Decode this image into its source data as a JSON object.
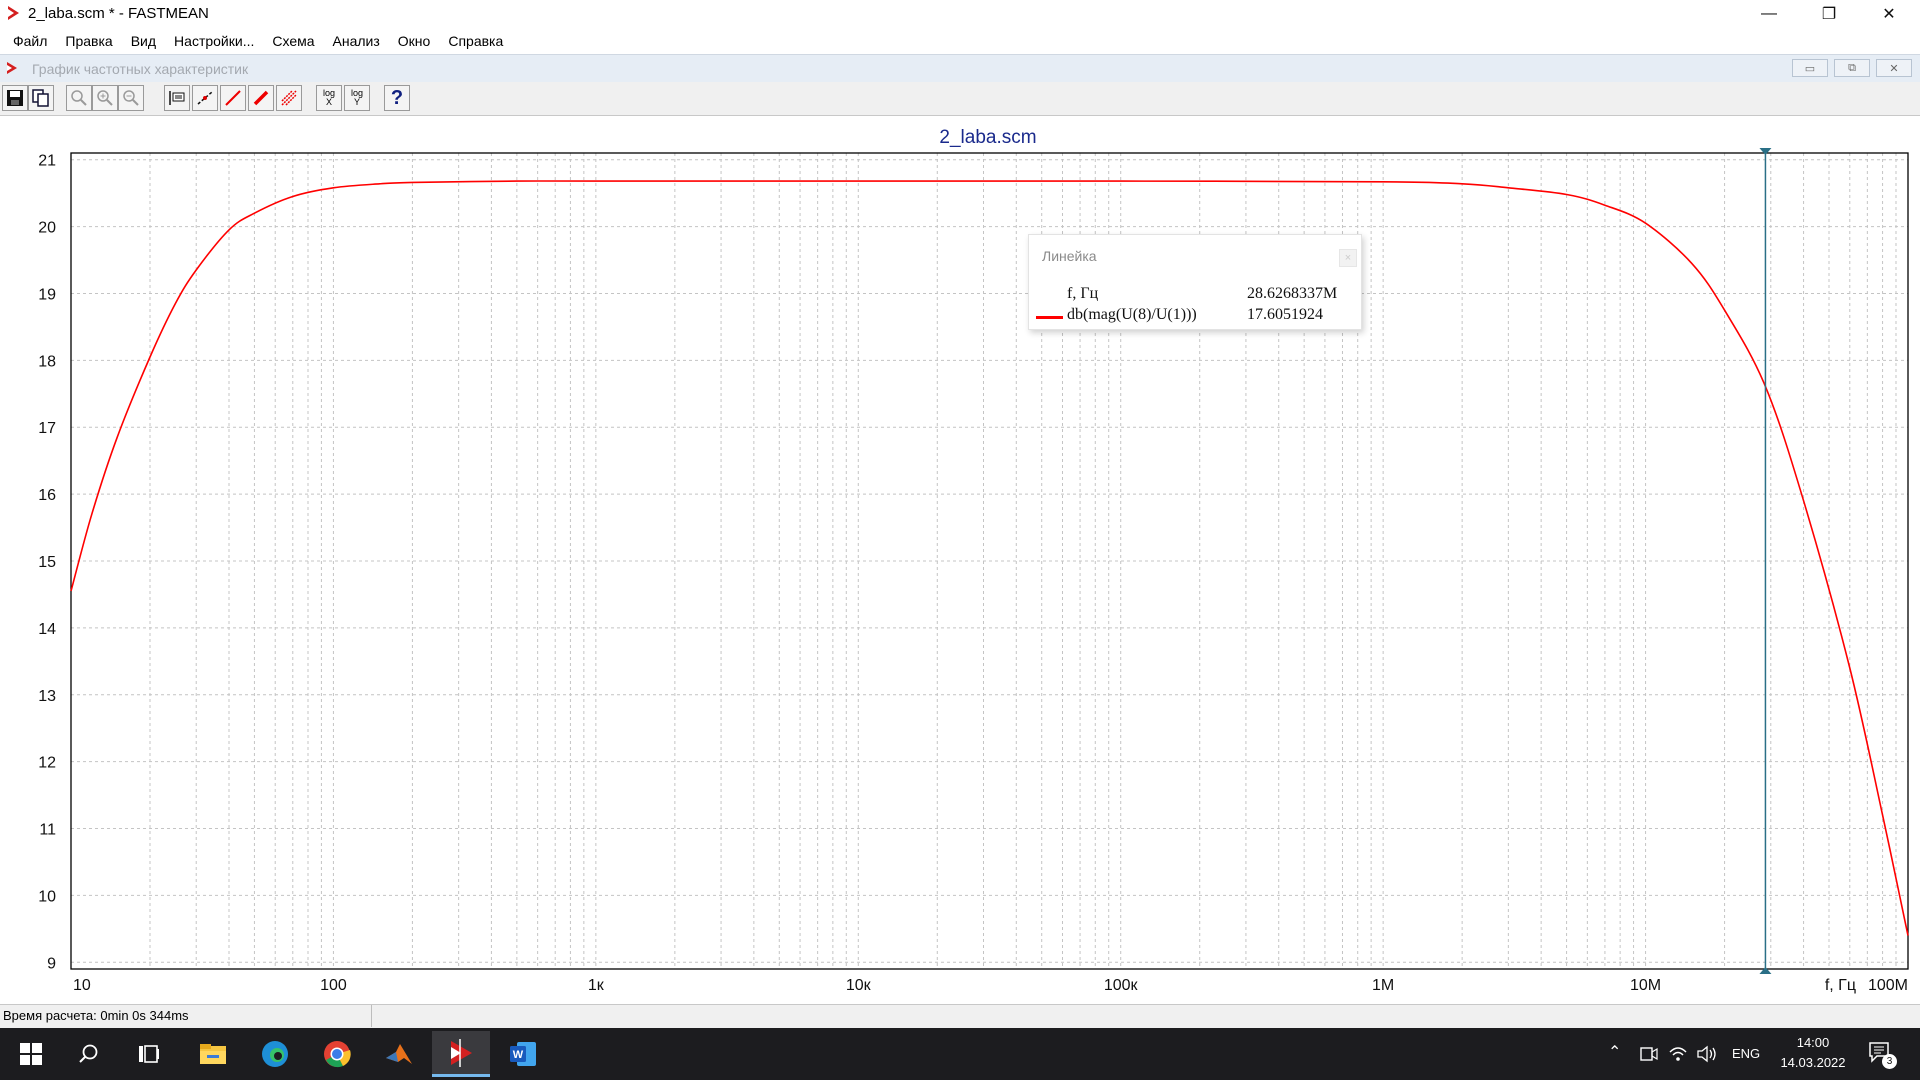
{
  "app": {
    "title": "2_laba.scm * - FASTMEAN",
    "window_controls": [
      "—",
      "❐",
      "✕"
    ]
  },
  "menu": [
    "Файл",
    "Правка",
    "Вид",
    "Настройки...",
    "Схема",
    "Анализ",
    "Окно",
    "Справка"
  ],
  "child_window": {
    "title": "График частотных характеристик",
    "controls": [
      "▭",
      "⧉",
      "✕"
    ]
  },
  "toolbar": {
    "buttons": [
      {
        "name": "save-icon"
      },
      {
        "name": "copy-icon"
      },
      {
        "name": "zoom-icon"
      },
      {
        "name": "zoom-in-icon"
      },
      {
        "name": "zoom-out-icon"
      },
      {
        "name": "ruler-icon"
      },
      {
        "name": "marker-line-icon"
      },
      {
        "name": "red-line-icon"
      },
      {
        "name": "red-pencil-icon"
      },
      {
        "name": "grid-icon"
      },
      {
        "name": "log-x-icon",
        "label_top": "log",
        "label_bottom": "X"
      },
      {
        "name": "log-y-icon",
        "label_top": "log",
        "label_bottom": "Y"
      },
      {
        "name": "help-icon",
        "label": "?"
      }
    ]
  },
  "chart_data": {
    "type": "line",
    "title": "2_laba.scm",
    "x_scale": "log",
    "xlim": [
      10,
      100000000
    ],
    "ylim": [
      8.9,
      21.1
    ],
    "x_tick_labels": [
      {
        "value": 10,
        "label": "10"
      },
      {
        "value": 100,
        "label": "100"
      },
      {
        "value": 1000,
        "label": "1к"
      },
      {
        "value": 10000,
        "label": "10к"
      },
      {
        "value": 100000,
        "label": "100к"
      },
      {
        "value": 1000000,
        "label": "1M"
      },
      {
        "value": 10000000,
        "label": "10M"
      },
      {
        "value": 100000000,
        "label": "100M"
      }
    ],
    "x_axis_name": "f, Гц",
    "y_ticks": [
      9,
      10,
      11,
      12,
      13,
      14,
      15,
      16,
      17,
      18,
      19,
      20,
      21
    ],
    "grid": true,
    "cursor_x": 28626833.7,
    "series": [
      {
        "name": "db(mag(U(8)/U(1)))",
        "color": "#ff0000",
        "points": [
          [
            10,
            14.55
          ],
          [
            12,
            15.7
          ],
          [
            15,
            16.85
          ],
          [
            20,
            18.05
          ],
          [
            25,
            18.85
          ],
          [
            30,
            19.35
          ],
          [
            40,
            19.95
          ],
          [
            50,
            20.2
          ],
          [
            70,
            20.45
          ],
          [
            100,
            20.58
          ],
          [
            150,
            20.64
          ],
          [
            200,
            20.66
          ],
          [
            500,
            20.68
          ],
          [
            1000,
            20.68
          ],
          [
            10000,
            20.68
          ],
          [
            100000,
            20.68
          ],
          [
            1000000,
            20.67
          ],
          [
            2000000,
            20.64
          ],
          [
            3000000,
            20.58
          ],
          [
            5000000,
            20.48
          ],
          [
            7000000,
            20.32
          ],
          [
            10000000,
            20.05
          ],
          [
            15000000,
            19.45
          ],
          [
            20000000,
            18.75
          ],
          [
            28626833.7,
            17.61
          ],
          [
            40000000,
            15.9
          ],
          [
            60000000,
            13.4
          ],
          [
            80000000,
            11.2
          ],
          [
            100000000,
            9.4
          ]
        ]
      }
    ]
  },
  "ruler": {
    "title": "Линейка",
    "close": "×",
    "rows": [
      {
        "label": "f, Гц",
        "value": "28.6268337M"
      },
      {
        "label": "db(mag(U(8)/U(1)))",
        "value": "17.6051924",
        "color": "#ff0000"
      }
    ]
  },
  "status": {
    "calc_time": "Время расчета: 0min 0s 344ms"
  },
  "taskbar": {
    "apps": [
      "windows-start",
      "search",
      "task-view",
      "file-explorer",
      "edge",
      "chrome",
      "matlab",
      "fastmean",
      "word"
    ],
    "language": "ENG",
    "time": "14:00",
    "date": "14.03.2022",
    "notifications": "3"
  }
}
